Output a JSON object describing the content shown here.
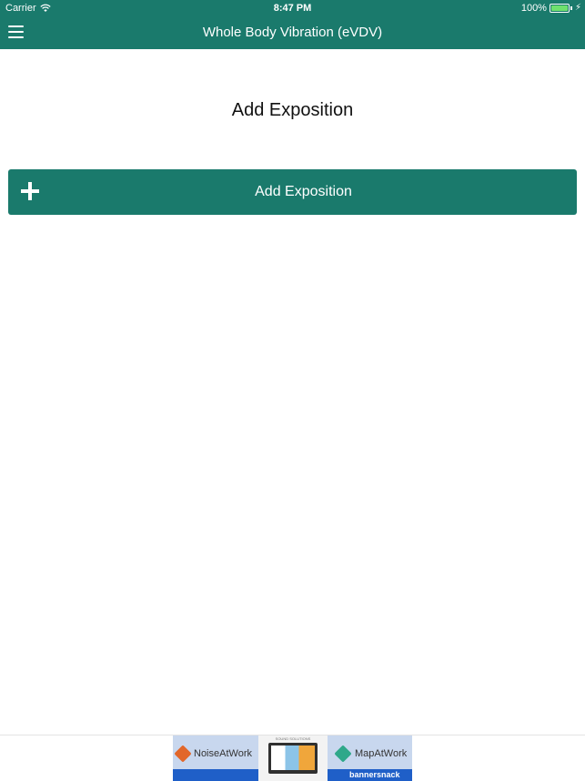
{
  "status_bar": {
    "carrier": "Carrier",
    "time": "8:47 PM",
    "battery": "100%",
    "icons": [
      "wifi-icon",
      "battery-icon",
      "bolt-icon"
    ]
  },
  "nav": {
    "title": "Whole Body Vibration (eVDV)",
    "menu_icon": "hamburger-menu-icon"
  },
  "main": {
    "heading": "Add Exposition",
    "add_button_label": "Add Exposition",
    "add_button_icon": "plus-icon"
  },
  "ad": {
    "left_text": "NoiseAtWork",
    "right_text": "MapAtWork",
    "mid_header": "SOUND SOLUTIONS",
    "brand": "bannersnack"
  },
  "colors": {
    "primary": "#1a7a6c",
    "background": "#ffffff",
    "heading_text": "#111111"
  }
}
